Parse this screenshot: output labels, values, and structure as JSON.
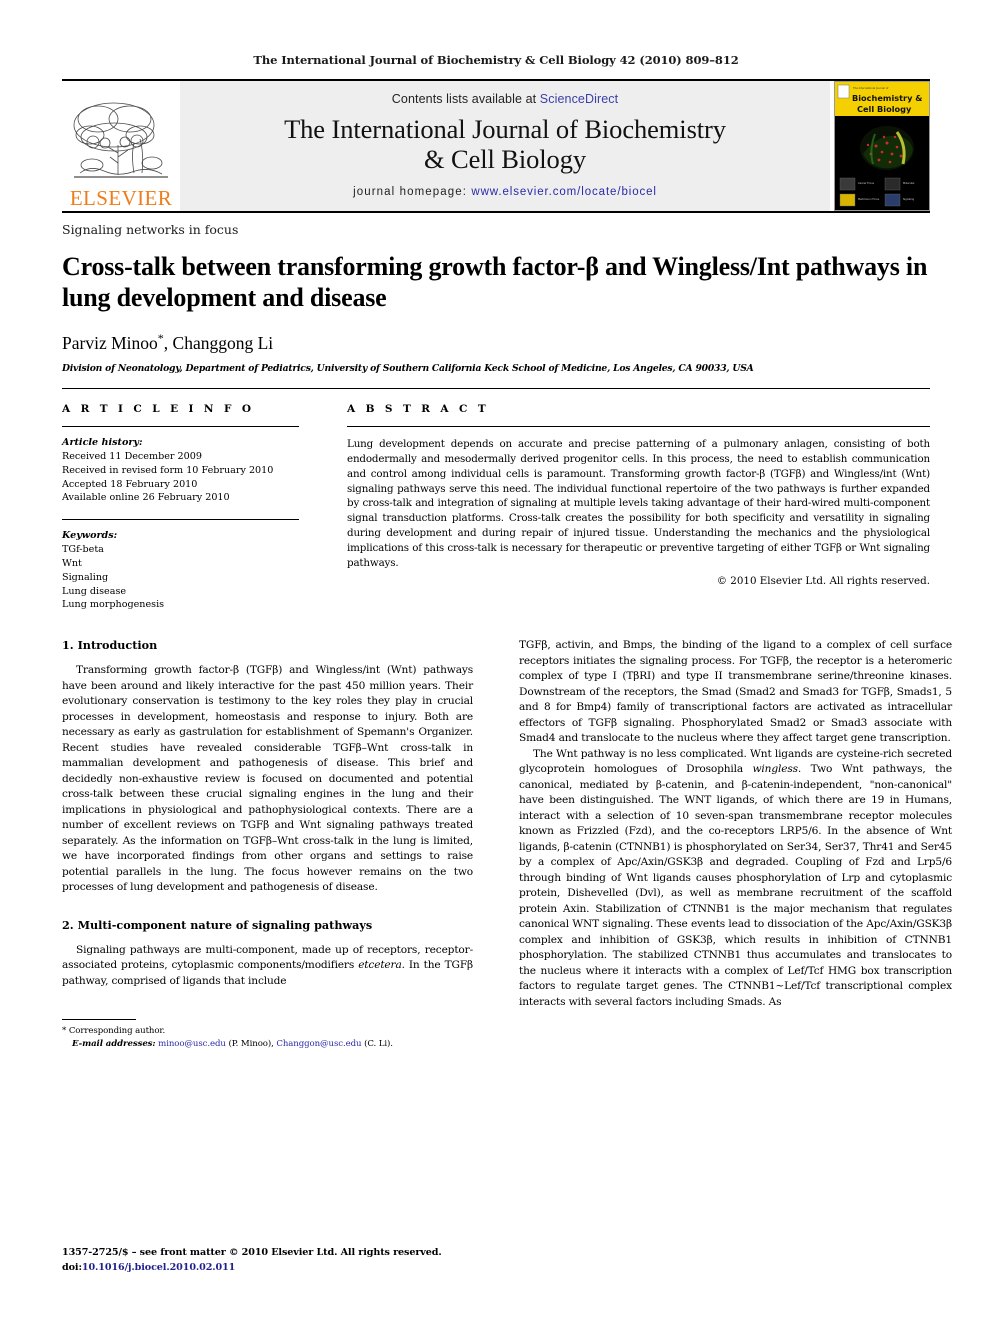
{
  "running_head": "The International Journal of Biochemistry & Cell Biology 42 (2010) 809–812",
  "masthead": {
    "publisher_name": "ELSEVIER",
    "contents_prefix": "Contents lists available at ",
    "contents_link": "ScienceDirect",
    "journal_title_line1": "The International Journal of Biochemistry",
    "journal_title_line2": "& Cell Biology",
    "homepage_label": "journal homepage:",
    "homepage_url": "www.elsevier.com/locate/biocel",
    "cover": {
      "banner_top": "The International Journal of",
      "banner_line1": "Biochemistry &",
      "banner_line2": "Cell Biology",
      "panel_labels": [
        "Cancer Focus",
        "Molecular Anthology",
        "Medicine in Focus",
        "Signaling Networks"
      ]
    }
  },
  "article": {
    "section_label": "Signaling networks in focus",
    "title": "Cross-talk between transforming growth factor-β and Wingless/Int pathways in lung development and disease",
    "authors": "Parviz Minoo",
    "authors_mark": "*",
    "authors_rest": ", Changgong Li",
    "affiliation": "Division of Neonatology, Department of Pediatrics, University of Southern California Keck School of Medicine, Los Angeles, CA 90033, USA"
  },
  "article_info": {
    "heading": "A R T I C L E    I N F O",
    "history_label": "Article history:",
    "history": [
      "Received 11 December 2009",
      "Received in revised form 10 February 2010",
      "Accepted 18 February 2010",
      "Available online 26 February 2010"
    ],
    "keywords_label": "Keywords:",
    "keywords": [
      "TGf-beta",
      "Wnt",
      "Signaling",
      "Lung disease",
      "Lung morphogenesis"
    ]
  },
  "abstract": {
    "heading": "A B S T R A C T",
    "text": "Lung development depends on accurate and precise patterning of a pulmonary anlagen, consisting of both endodermally and mesodermally derived progenitor cells. In this process, the need to establish communication and control among individual cells is paramount. Transforming growth factor-β (TGFβ) and Wingless/int (Wnt) signaling pathways serve this need. The individual functional repertoire of the two pathways is further expanded by cross-talk and integration of signaling at multiple levels taking advantage of their hard-wired multi-component signal transduction platforms. Cross-talk creates the possibility for both specificity and versatility in signaling during development and during repair of injured tissue. Understanding the mechanics and the physiological implications of this cross-talk is necessary for therapeutic or preventive targeting of either TGFβ or Wnt signaling pathways.",
    "copyright": "© 2010 Elsevier Ltd. All rights reserved."
  },
  "body": {
    "left": {
      "heading_1": "1.  Introduction",
      "para_1": "Transforming growth factor-β (TGFβ) and Wingless/int (Wnt) pathways have been around and likely interactive for the past 450 million years. Their evolutionary conservation is testimony to the key roles they play in crucial processes in development, homeostasis and response to injury. Both are necessary as early as gastrulation for establishment of Spemann's Organizer. Recent studies have revealed considerable TGFβ–Wnt cross-talk in mammalian development and pathogenesis of disease. This brief and decidedly non-exhaustive review is focused on documented and potential cross-talk between these crucial signaling engines in the lung and their implications in physiological and pathophysiological contexts. There are a number of excellent reviews on TGFβ and Wnt signaling pathways treated separately. As the information on TGFβ–Wnt cross-talk in the lung is limited, we have incorporated findings from other organs and settings to raise potential parallels in the lung. The focus however remains on the two processes of lung development and pathogenesis of disease.",
      "heading_2": "2.  Multi-component nature of signaling pathways",
      "para_2_a": "Signaling pathways are multi-component, made up of receptors, receptor-associated proteins, cytoplasmic components/modifiers ",
      "para_2_italic": "etcetera",
      "para_2_b": ". In the TGFβ pathway, comprised of ligands that include"
    },
    "right": {
      "para_1": "TGFβ, activin, and Bmps, the binding of the ligand to a complex of cell surface receptors initiates the signaling process. For TGFβ, the receptor is a heteromeric complex of type I (TβRI) and type II transmembrane serine/threonine kinases. Downstream of the receptors, the Smad (Smad2 and Smad3 for TGFβ, Smads1, 5 and 8 for Bmp4) family of transcriptional factors are activated as intracellular effectors of TGFβ signaling. Phosphorylated Smad2 or Smad3 associate with Smad4 and translocate to the nucleus where they affect target gene transcription.",
      "para_2_a": "The Wnt pathway is no less complicated. Wnt ligands are cysteine-rich secreted glycoprotein homologues of Drosophila ",
      "para_2_italic": "wingless",
      "para_2_b": ". Two Wnt pathways, the canonical, mediated by β-catenin, and β-catenin-independent, \"non-canonical\" have been distinguished. The WNT ligands, of which there are 19 in Humans, interact with a selection of 10 seven-span transmembrane receptor molecules known as Frizzled (Fzd), and the co-receptors LRP5/6. In the absence of Wnt ligands, β-catenin (CTNNB1) is phosphorylated on Ser34, Ser37, Thr41 and Ser45 by a complex of Apc/Axin/GSK3β and degraded. Coupling of Fzd and Lrp5/6 through binding of Wnt ligands causes phosphorylation of Lrp and cytoplasmic protein, Dishevelled (Dvl), as well as membrane recruitment of the scaffold protein Axin. Stabilization of CTNNB1 is the major mechanism that regulates canonical WNT signaling. These events lead to dissociation of the Apc/Axin/GSK3β complex and inhibition of GSK3β, which results in inhibition of CTNNB1 phosphorylation. The stabilized CTNNB1 thus accumulates and translocates to the nucleus where it interacts with a complex of Lef/Tcf HMG box transcription factors to regulate target genes. The CTNNB1~Lef/Tcf transcriptional complex interacts with several factors including Smads. As"
    }
  },
  "footnote": {
    "corresponding": "* Corresponding author.",
    "email_label": "E-mail addresses:",
    "email_1": "minoo@usc.edu",
    "email_1_who": "(P. Minoo)",
    "email_2": "Changgon@usc.edu",
    "email_2_who": "(C. Li)."
  },
  "footer": {
    "issn_line": "1357-2725/$ – see front matter © 2010 Elsevier Ltd. All rights reserved.",
    "doi_label": "doi:",
    "doi_value": "10.1016/j.biocel.2010.02.011"
  },
  "colors": {
    "elsevier_orange": "#ef7d1a",
    "link_blue": "#2a2aa8",
    "band_gray": "#eeeeee",
    "cover_yellow": "#f5d000"
  }
}
